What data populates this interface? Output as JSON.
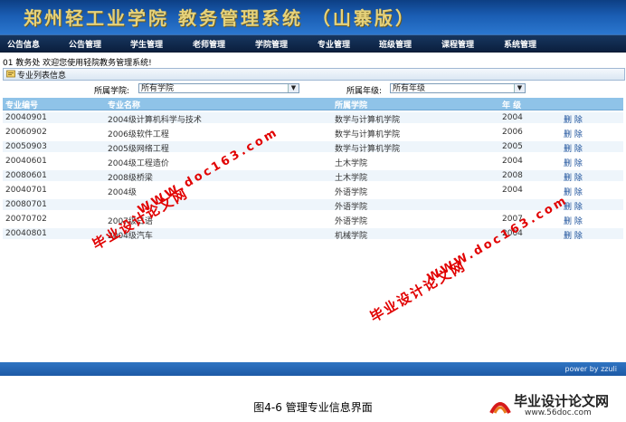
{
  "header": {
    "title": "郑州轻工业学院 教务管理系统 （山寨版）"
  },
  "nav": {
    "items": [
      "公告信息",
      "公告管理",
      "学生管理",
      "老师管理",
      "学院管理",
      "专业管理",
      "班级管理",
      "课程管理",
      "系统管理"
    ]
  },
  "welcome": "01 教务处 欢迎您使用轻院教务管理系统!",
  "panel": {
    "title": "专业列表信息"
  },
  "filters": {
    "college_label": "所属学院:",
    "college_value": "所有学院",
    "grade_label": "所属年级:",
    "grade_value": "所有年级"
  },
  "table": {
    "headers": [
      "专业编号",
      "专业名称",
      "所属学院",
      "年 级"
    ],
    "delete_label": "删 除",
    "rows": [
      {
        "id": "20040901",
        "name": "2004级计算机科学与技术",
        "college": "数学与计算机学院",
        "grade": "2004"
      },
      {
        "id": "20060902",
        "name": "2006级软件工程",
        "college": "数学与计算机学院",
        "grade": "2006"
      },
      {
        "id": "20050903",
        "name": "2005级网络工程",
        "college": "数学与计算机学院",
        "grade": "2005"
      },
      {
        "id": "20040601",
        "name": "2004级工程造价",
        "college": "土木学院",
        "grade": "2004"
      },
      {
        "id": "20080601",
        "name": "2008级桥梁",
        "college": "土木学院",
        "grade": "2008"
      },
      {
        "id": "20040701",
        "name": "2004级",
        "college": "外语学院",
        "grade": "2004"
      },
      {
        "id": "20080701",
        "name": "",
        "college": "外语学院",
        "grade": ""
      },
      {
        "id": "20070702",
        "name": "2007级日语",
        "college": "外语学院",
        "grade": "2007"
      },
      {
        "id": "20040801",
        "name": "2004级汽车",
        "college": "机械学院",
        "grade": "2004"
      }
    ]
  },
  "footer": {
    "power": "power by zzuli"
  },
  "caption": "图4-6 管理专业信息界面",
  "watermarks": {
    "cn": "毕业设计论文网",
    "url": "WWW.doc163.com"
  },
  "logo": {
    "cn": "毕业设计论文网",
    "url": "www.56doc.com"
  }
}
